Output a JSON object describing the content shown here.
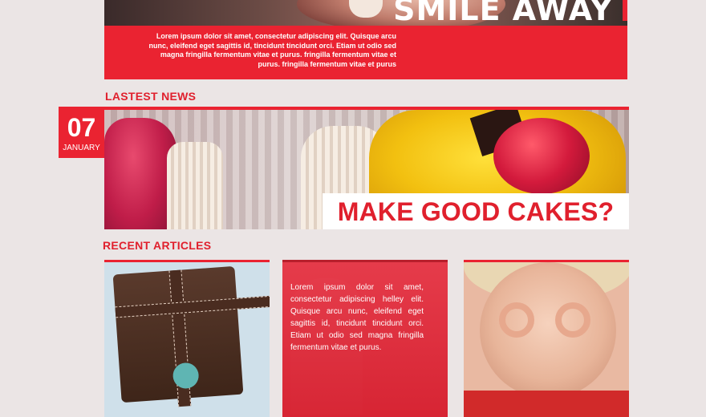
{
  "hero": {
    "title": "SMILE AWAY",
    "text": "Lorem ipsum dolor sit amet, consectetur adipiscing elit. Quisque arcu nunc, eleifend eget sagittis id, tincidunt tincidunt orci. Etiam ut odio sed magna fringilla fermentum vitae et purus. fringilla fermentum vitae et purus. fringilla fermentum vitae et purus"
  },
  "latest_news": {
    "heading": "LASTEST NEWS",
    "day": "07",
    "month": "JANUARY",
    "caption": "MAKE GOOD CAKES?"
  },
  "recent_articles": {
    "heading": "RECENT ARTICLES",
    "card_text": "Lorem ipsum dolor sit amet, consectetur adipiscing helley elit. Quisque arcu nunc, eleifend eget sagittis id, tincidunt tincidunt orci. Etiam ut odio sed magna fringilla fermentum vitae et purus."
  },
  "colors": {
    "accent": "#ea2331",
    "background": "#ebe5e5"
  }
}
